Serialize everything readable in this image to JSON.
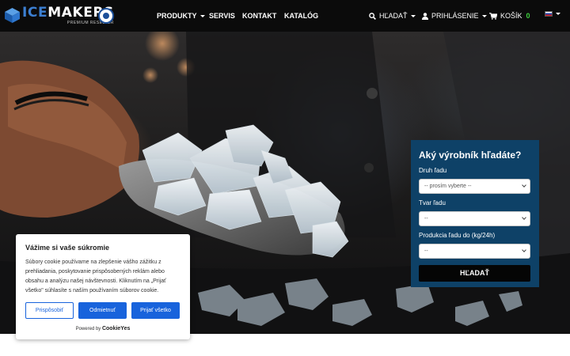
{
  "brand": {
    "logo_ice": "ICE",
    "logo_rest": "MAKERS",
    "logo_sub": "PREMIUM RESELLER"
  },
  "nav": {
    "products": "PRODUKTY",
    "service": "SERVIS",
    "contact": "KONTAKT",
    "catalog": "KATALÓG",
    "search": "HĽADAŤ",
    "login": "PRIHLÁSENIE",
    "cart": "KOŠÍK",
    "cart_count": "0"
  },
  "search_box": {
    "title": "Aký výrobník hľadáte?",
    "ice_type_label": "Druh ľadu",
    "ice_type_value": "-- prosím vyberte --",
    "ice_shape_label": "Tvar ľadu",
    "ice_shape_value": "--",
    "production_label": "Produkcia ľadu do (kg/24h)",
    "production_value": "--",
    "submit": "HĽADAŤ"
  },
  "cookie": {
    "title": "Vážime si vaše súkromie",
    "text": "Súbory cookie používame na zlepšenie vášho zážitku z prehliadania, poskytovanie prispôsobených reklám alebo obsahu a analýzu našej návštevnosti. Kliknutím na „Prijať všetko\" súhlasíte s naším používaním súborov cookie.",
    "customize": "Prispôsobiť",
    "reject": "Odmietnuť",
    "accept": "Prijať všetko",
    "powered_by": "Powered by",
    "powered_brand": "CookieYes"
  },
  "colors": {
    "navbar": "#0b0b0b",
    "search_panel": "#0e4167",
    "accent_blue": "#1863dc",
    "cart_green": "#3fd13f"
  },
  "icons": [
    "ice-cube-logo",
    "partner-badge",
    "search-icon",
    "user-icon",
    "cart-icon",
    "slovak-flag-icon"
  ]
}
